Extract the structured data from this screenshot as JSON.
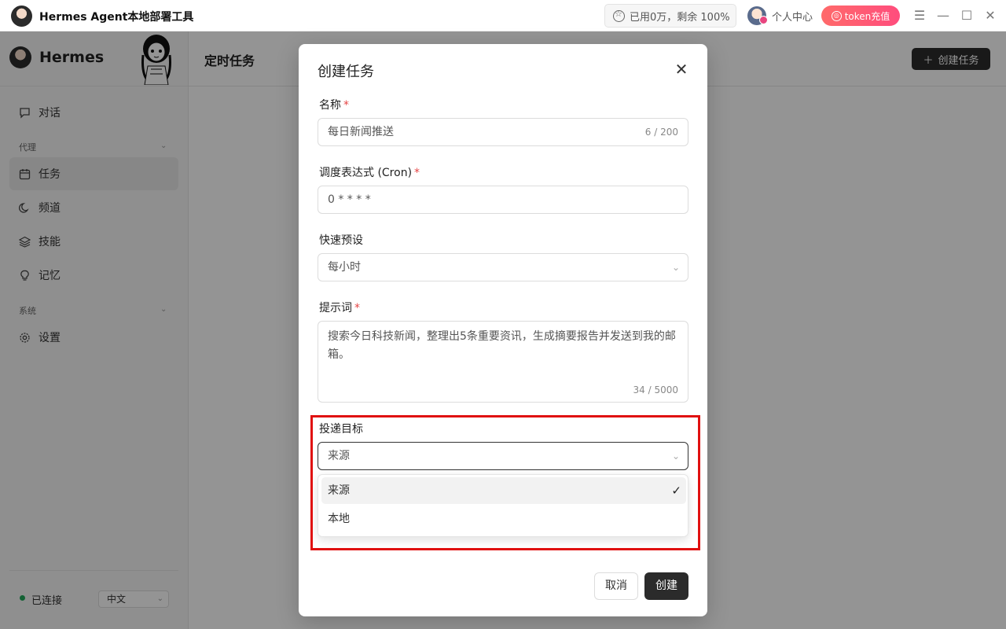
{
  "titlebar": {
    "app_title": "Hermes Agent本地部署工具",
    "usage": "已用0万，剩余 100%",
    "user_center": "个人中心",
    "token_button": "token充值"
  },
  "sidebar": {
    "brand": "Hermes",
    "items": [
      {
        "label": "对话",
        "icon": "chat-icon"
      },
      {
        "group": "代理"
      },
      {
        "label": "任务",
        "icon": "calendar-icon",
        "active": true
      },
      {
        "label": "频道",
        "icon": "moon-icon"
      },
      {
        "label": "技能",
        "icon": "layers-icon"
      },
      {
        "label": "记忆",
        "icon": "lightbulb-icon"
      },
      {
        "group": "系统"
      },
      {
        "label": "设置",
        "icon": "gear-icon"
      }
    ],
    "status": "已连接",
    "language": "中文"
  },
  "main": {
    "page_title": "定时任务",
    "create_button": "创建任务"
  },
  "modal": {
    "title": "创建任务",
    "name_label": "名称",
    "name_value": "每日新闻推送",
    "name_counter": "6 / 200",
    "cron_label": "调度表达式 (Cron)",
    "cron_value": "0 * * * *",
    "preset_label": "快速预设",
    "preset_value": "每小时",
    "prompt_label": "提示词",
    "prompt_value": "搜索今日科技新闻，整理出5条重要资讯，生成摘要报告并发送到我的邮箱。",
    "prompt_counter": "34 / 5000",
    "target_label": "投递目标",
    "target_value": "来源",
    "target_options": [
      "来源",
      "本地"
    ],
    "cancel": "取消",
    "create": "创建"
  },
  "colors": {
    "required": "#e54545",
    "highlight": "#e01010",
    "primary": "#2b2b2b",
    "status_ok": "#22a85a"
  }
}
